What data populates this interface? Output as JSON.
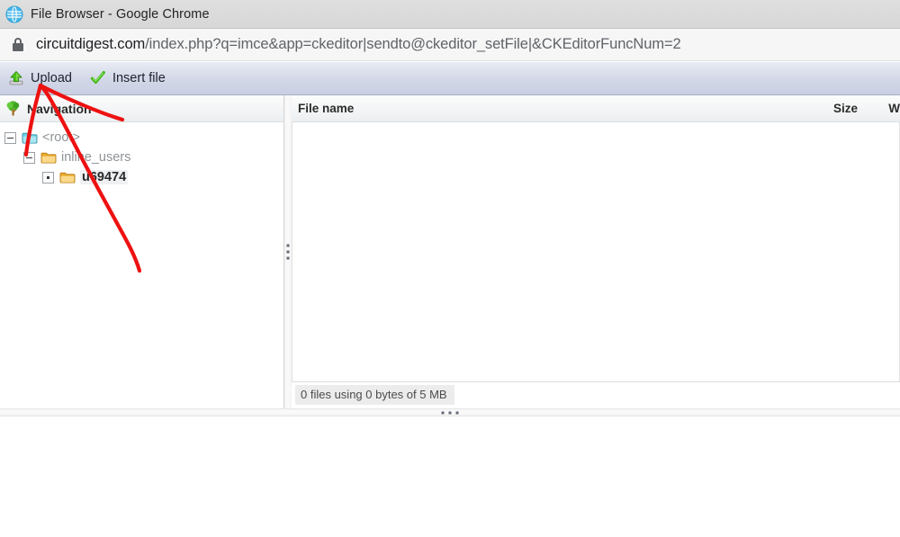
{
  "window": {
    "title": "File Browser - Google Chrome",
    "app_icon": "chrome-globe-icon"
  },
  "addressbar": {
    "security_icon": "lock-icon",
    "host": "circuitdigest.com",
    "path": "/index.php?q=imce&app=ckeditor|sendto@ckeditor_setFile|&CKEditorFuncNum=2",
    "full_url": "circuitdigest.com/index.php?q=imce&app=ckeditor|sendto@ckeditor_setFile|&CKEditorFuncNum=2"
  },
  "toolbar": {
    "buttons": [
      {
        "label": "Upload",
        "icon": "upload-arrow-icon"
      },
      {
        "label": "Insert file",
        "icon": "green-check-icon"
      }
    ]
  },
  "navigation": {
    "header_label": "Navigation",
    "header_icon": "tree-icon",
    "tree": [
      {
        "label": "<root>",
        "level": 0,
        "state": "expanded",
        "icon": "folder-root-icon",
        "selected": false
      },
      {
        "label": "inline_users",
        "level": 1,
        "state": "expanded",
        "icon": "folder-icon",
        "selected": false
      },
      {
        "label": "u69474",
        "level": 2,
        "state": "leaf",
        "icon": "folder-icon",
        "selected": true
      }
    ]
  },
  "filelist": {
    "columns": [
      {
        "key": "name",
        "label": "File name"
      },
      {
        "key": "size",
        "label": "Size"
      },
      {
        "key": "width",
        "label": "W"
      }
    ],
    "rows": [],
    "status": "0 files using 0 bytes of 5 MB"
  },
  "splitters": {
    "vertical_handle": "vertical-resize-handle",
    "horizontal_handle": "horizontal-resize-handle"
  },
  "annotation": {
    "type": "hand-drawn-arrow",
    "color": "#ee1111",
    "points_to": "Upload"
  },
  "colors": {
    "toolbar_top": "#e9ecf4",
    "toolbar_bottom": "#c9cfe2",
    "annotation_red": "#ee1111",
    "link_gray": "#8f9396",
    "header_text": "#2b2b2b"
  }
}
